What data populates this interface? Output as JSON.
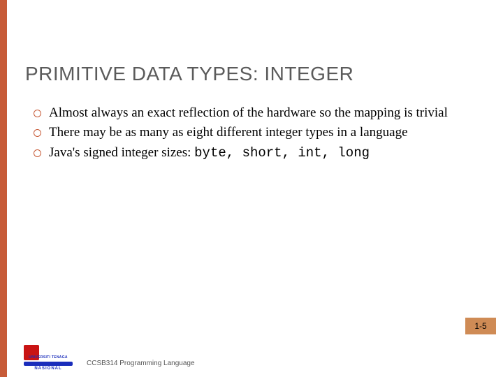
{
  "title": "PRIMITIVE DATA TYPES: INTEGER",
  "bullets": [
    {
      "text": "Almost always an exact reflection of the hardware so the mapping is trivial"
    },
    {
      "text": "There may be as many as eight different integer types in a language"
    },
    {
      "prefix": "Java's signed integer sizes: ",
      "code": "byte, short, int, long"
    }
  ],
  "page_number": "1-5",
  "footer": "CCSB314 Programming Language",
  "logo": {
    "line1": "UNIVERSITI TENAGA",
    "line2": "NASIONAL"
  }
}
